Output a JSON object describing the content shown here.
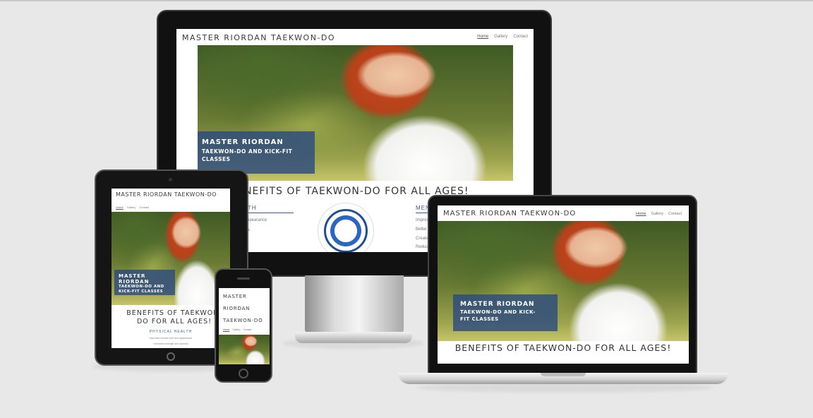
{
  "site": {
    "brand": "MASTER RIORDAN TAEKWON-DO",
    "brand_phone_lines": [
      "MASTER",
      "RIORDAN",
      "TAEKWON-DO"
    ],
    "nav": [
      "Home",
      "Gallery",
      "Contact"
    ],
    "hero_title": "MASTER RIORDAN",
    "hero_subtitle": "TAEKWON-DO AND KICK-FIT CLASSES",
    "benefits_heading": "BENEFITS OF TAEKWON-DO FOR ALL AGES!",
    "benefits_monitor_partial": "NEFITS OF TAEKWON-DO FOR ALL AGES!",
    "benefits_tablet_lines": [
      "BENEFITS OF TAEKWON-",
      "DO FOR ALL AGES!"
    ],
    "physical_health": "PHYSICAL HEALTH",
    "physical_partial": "LTH",
    "mental_partial": "MEN",
    "physical_items_partial": [
      "Appearance",
      "ina"
    ],
    "mental_items_partial": [
      "Improv",
      "Better",
      "Create",
      "Reduc"
    ],
    "tablet_items": [
      "Improved muscle tone and appearance",
      "Increased strength and stamina"
    ],
    "emblem_text": "UNITED TAEKWON-DO FEDERATION"
  },
  "colors": {
    "accent_blue": "#284682",
    "background": "#e8e8e8",
    "device_black": "#111111"
  }
}
